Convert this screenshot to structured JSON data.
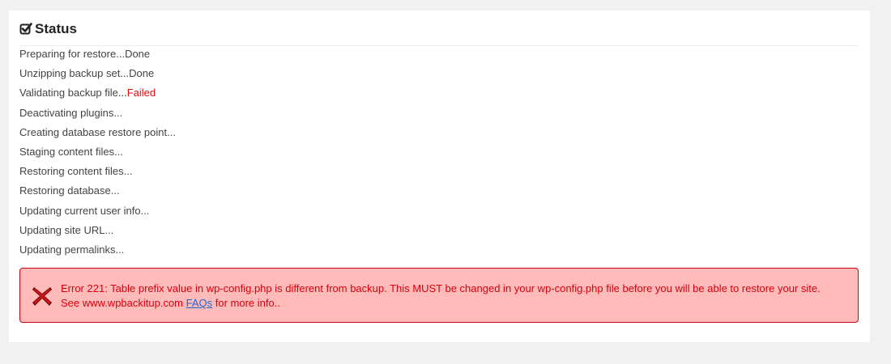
{
  "status": {
    "title": "Status",
    "header_icon": "check-square-icon",
    "steps": [
      {
        "label": "Preparing for restore...",
        "result": "Done",
        "state": "done"
      },
      {
        "label": "Unzipping backup set...",
        "result": "Done",
        "state": "done"
      },
      {
        "label": "Validating backup file...",
        "result": "Failed",
        "state": "failed"
      },
      {
        "label": "Deactivating plugins...",
        "result": "",
        "state": "pending"
      },
      {
        "label": "Creating database restore point...",
        "result": "",
        "state": "pending"
      },
      {
        "label": "Staging content files...",
        "result": "",
        "state": "pending"
      },
      {
        "label": "Restoring content files...",
        "result": "",
        "state": "pending"
      },
      {
        "label": "Restoring database...",
        "result": "",
        "state": "pending"
      },
      {
        "label": "Updating current user info...",
        "result": "",
        "state": "pending"
      },
      {
        "label": "Updating site URL...",
        "result": "",
        "state": "pending"
      },
      {
        "label": "Updating permalinks...",
        "result": "",
        "state": "pending"
      }
    ]
  },
  "error": {
    "icon": "error-x-icon",
    "line1": "Error 221: Table prefix value in wp-config.php is different from backup. This MUST be changed in your wp-config.php file before you will be able to restore your site.",
    "line2_prefix": "See www.wpbackitup.com ",
    "link_label": "FAQs",
    "line2_suffix": " for more info.."
  },
  "colors": {
    "failed": "#dd1111",
    "error_background": "#ffbaba",
    "error_border": "#d8000c",
    "link": "#2266cc"
  }
}
